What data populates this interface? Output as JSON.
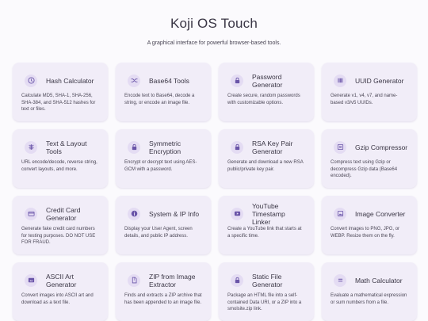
{
  "header": {
    "title": "Koji OS Touch",
    "subtitle": "A graphical interface for powerful browser-based tools."
  },
  "theme": {
    "page_background": "#fbfafd",
    "card_background": "#f1edf8",
    "icon_background": "#e4dcf3",
    "icon_color": "#6a55a8"
  },
  "tools": [
    {
      "title": "Hash Calculator",
      "icon": "clock-icon",
      "description": "Calculate MD5, SHA-1, SHA-256, SHA-384, and SHA-512 hashes for text or files."
    },
    {
      "title": "Base64 Tools",
      "icon": "shuffle-icon",
      "description": "Encode text to Base64, decode a string, or encode an image file."
    },
    {
      "title": "Password Generator",
      "icon": "lock-icon",
      "description": "Create secure, random passwords with customizable options."
    },
    {
      "title": "UUID Generator",
      "icon": "barcode-icon",
      "description": "Generate v1, v4, v7, and name-based v3/v5 UUIDs."
    },
    {
      "title": "Text & Layout Tools",
      "icon": "text-align-icon",
      "description": "URL encode/decode, reverse string, convert layouts, and more."
    },
    {
      "title": "Symmetric Encryption",
      "icon": "lock-icon",
      "description": "Encrypt or decrypt text using AES-GCM with a password."
    },
    {
      "title": "RSA Key Pair Generator",
      "icon": "lock-icon",
      "description": "Generate and download a new RSA public/private key pair."
    },
    {
      "title": "Gzip Compressor",
      "icon": "compress-icon",
      "description": "Compress text using Gzip or decompress Gzip data (Base64 encoded)."
    },
    {
      "title": "Credit Card Generator",
      "icon": "credit-card-icon",
      "description": "Generate fake credit card numbers for testing purposes. DO NOT USE FOR FRAUD."
    },
    {
      "title": "System & IP Info",
      "icon": "info-icon",
      "description": "Display your User Agent, screen details, and public IP address."
    },
    {
      "title": "YouTube Timestamp Linker",
      "icon": "play-icon",
      "description": "Create a YouTube link that starts at a specific time."
    },
    {
      "title": "Image Converter",
      "icon": "image-icon",
      "description": "Convert images to PNG, JPG, or WEBP. Resize them on the fly."
    },
    {
      "title": "ASCII Art Generator",
      "icon": "ascii-art-icon",
      "description": "Convert images into ASCII art and download as a text file."
    },
    {
      "title": "ZIP from Image Extractor",
      "icon": "zip-file-icon",
      "description": "Finds and extracts a ZIP archive that has been appended to an image file."
    },
    {
      "title": "Static File Generator",
      "icon": "lock-icon",
      "description": "Package an HTML file into a self-contained Data URI, or a ZIP into a smolsite.zip link."
    },
    {
      "title": "Math Calculator",
      "icon": "equals-icon",
      "description": "Evaluate a mathematical expression or sum numbers from a file."
    }
  ]
}
